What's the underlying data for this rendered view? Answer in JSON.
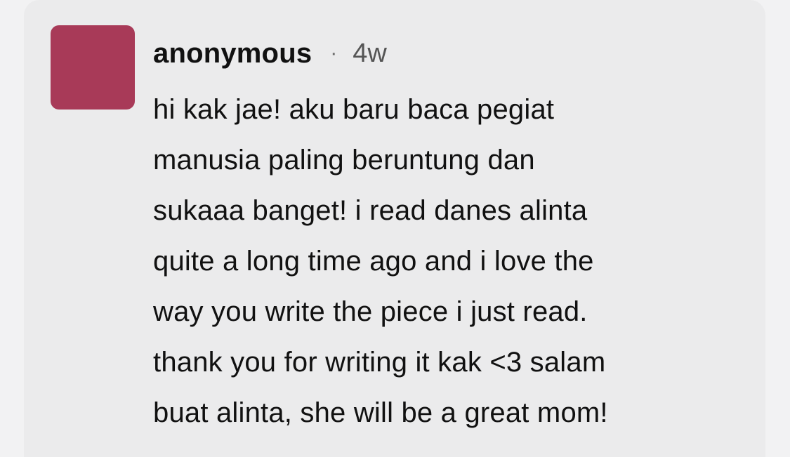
{
  "comment": {
    "author": "anonymous",
    "separator": "·",
    "time": "4w",
    "avatar_color": "#a83a58",
    "text_lines": [
      "hi kak jae! aku baru baca pegiat",
      "manusia paling beruntung dan",
      "sukaaa banget! i read danes alinta",
      "quite a long time ago and i love the",
      "way you write the piece i just read.",
      "thank you for writing it kak <3 salam",
      "buat alinta, she will be a great mom!"
    ]
  }
}
